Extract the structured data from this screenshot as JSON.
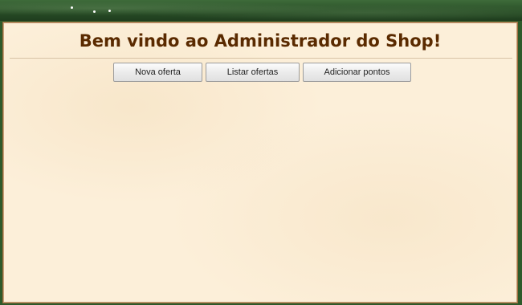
{
  "header": {
    "title": "Bem vindo ao Administrador do Shop!"
  },
  "toolbar": {
    "new_offer_label": "Nova oferta",
    "list_offers_label": "Listar ofertas",
    "add_points_label": "Adicionar pontos"
  },
  "colors": {
    "banner": "#2e5a2a",
    "panel_background": "#fcefd9",
    "panel_border": "#9a6b3f",
    "title_text": "#5a2a00"
  }
}
